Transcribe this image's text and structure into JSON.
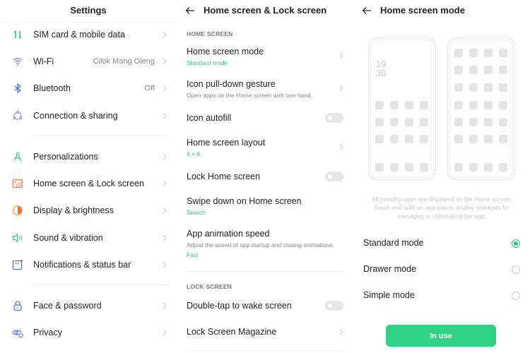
{
  "settings": {
    "title": "Settings",
    "items": [
      {
        "label": "SIM card & mobile data",
        "icon": "sim-data-icon",
        "value": ""
      },
      {
        "label": "Wi-Fi",
        "icon": "wifi-icon",
        "value": "Cilok Mang Oleng"
      },
      {
        "label": "Bluetooth",
        "icon": "bluetooth-icon",
        "value": "Off"
      },
      {
        "label": "Connection & sharing",
        "icon": "connection-icon",
        "value": ""
      },
      {
        "label": "Personalizations",
        "icon": "personalization-icon",
        "value": ""
      },
      {
        "label": "Home screen & Lock screen",
        "icon": "home-screen-icon",
        "value": ""
      },
      {
        "label": "Display & brightness",
        "icon": "brightness-icon",
        "value": ""
      },
      {
        "label": "Sound & vibration",
        "icon": "sound-icon",
        "value": ""
      },
      {
        "label": "Notifications & status bar",
        "icon": "notification-icon",
        "value": ""
      },
      {
        "label": "Face & password",
        "icon": "lock-icon",
        "value": ""
      },
      {
        "label": "Privacy",
        "icon": "privacy-icon",
        "value": ""
      }
    ]
  },
  "home_lock": {
    "title": "Home screen & Lock screen",
    "home_section": "HOME SCREEN",
    "lock_section": "LOCK SCREEN",
    "items": {
      "mode": {
        "label": "Home screen mode",
        "value": "Standard mode"
      },
      "pulldown": {
        "label": "Icon pull-down gesture",
        "desc": "Open apps on the Home screen with one hand."
      },
      "autofill": {
        "label": "Icon autofill",
        "on": false
      },
      "layout": {
        "label": "Home screen layout",
        "value": "4 × 6"
      },
      "lock_home": {
        "label": "Lock Home screen",
        "on": false
      },
      "swipe": {
        "label": "Swipe down on Home screen",
        "value": "Search"
      },
      "anim": {
        "label": "App animation speed",
        "desc": "Adjust the speed of app startup and closing animations.",
        "value": "Fast"
      },
      "double_tap": {
        "label": "Double-tap to wake screen",
        "on": false
      },
      "magazine": {
        "label": "Lock Screen Magazine"
      }
    }
  },
  "mode_screen": {
    "title": "Home screen mode",
    "clock_hour": "19",
    "clock_min": "30",
    "description": "All installed apps are displayed on the Home screen. Touch and hold an app icon to display shortcuts for managing or uninstalling the app.",
    "options": [
      {
        "label": "Standard mode",
        "selected": true
      },
      {
        "label": "Drawer mode",
        "selected": false
      },
      {
        "label": "Simple mode",
        "selected": false
      }
    ],
    "button": "In use"
  },
  "colors": {
    "accent": "#2fc582",
    "button": "#2fd184"
  }
}
